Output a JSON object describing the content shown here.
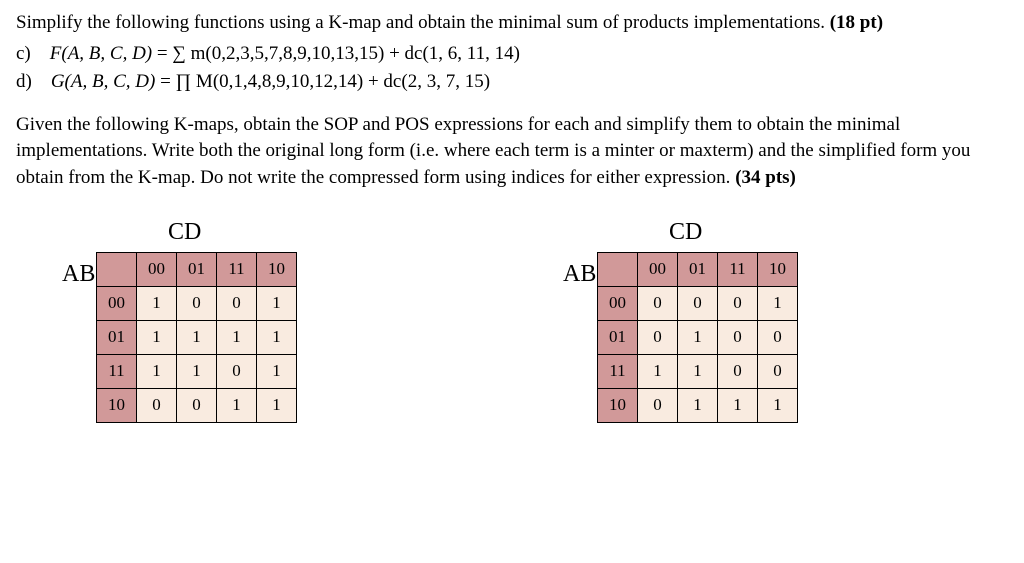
{
  "problem1": {
    "intro": "Simplify the following functions using a K-map and obtain the minimal sum of products implementations.",
    "points": "(18 pt)",
    "items": [
      {
        "letter": "c)",
        "func": "F(A, B, C, D)",
        "eq": "= ∑ m(0,2,3,5,7,8,9,10,13,15) + dc(1, 6, 11, 14)"
      },
      {
        "letter": "d)",
        "func": "G(A, B, C, D)",
        "eq": "= ∏ M(0,1,4,8,9,10,12,14) + dc(2, 3, 7, 15)"
      }
    ]
  },
  "problem2": {
    "text": "Given the following K-maps, obtain the SOP and POS expressions for each and simplify them to obtain the minimal implementations. Write both the original long form (i.e. where each term is a minter or maxterm) and the simplified form you obtain from the K-map. Do not write the compressed form using indices for either expression.",
    "points": "(34 pts)"
  },
  "kmap_labels": {
    "top": "CD",
    "left": "AB",
    "cols": [
      "00",
      "01",
      "11",
      "10"
    ],
    "rows": [
      "00",
      "01",
      "11",
      "10"
    ]
  },
  "chart_data": [
    {
      "type": "table",
      "title": "K-map 1",
      "row_labels": [
        "00",
        "01",
        "11",
        "10"
      ],
      "col_labels": [
        "00",
        "01",
        "11",
        "10"
      ],
      "data": [
        [
          "1",
          "0",
          "0",
          "1"
        ],
        [
          "1",
          "1",
          "1",
          "1"
        ],
        [
          "1",
          "1",
          "0",
          "1"
        ],
        [
          "0",
          "0",
          "1",
          "1"
        ]
      ]
    },
    {
      "type": "table",
      "title": "K-map 2",
      "row_labels": [
        "00",
        "01",
        "11",
        "10"
      ],
      "col_labels": [
        "00",
        "01",
        "11",
        "10"
      ],
      "data": [
        [
          "0",
          "0",
          "0",
          "1"
        ],
        [
          "0",
          "1",
          "0",
          "0"
        ],
        [
          "1",
          "1",
          "0",
          "0"
        ],
        [
          "0",
          "1",
          "1",
          "1"
        ]
      ]
    }
  ]
}
